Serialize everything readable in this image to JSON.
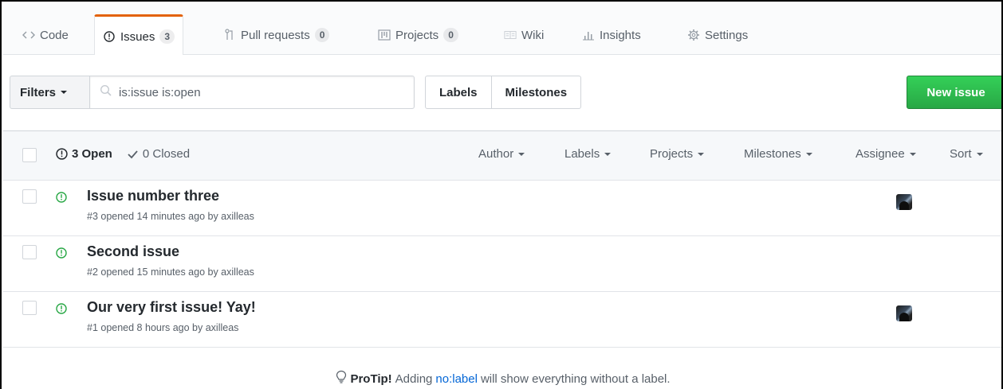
{
  "tabs": [
    {
      "label": "Code",
      "icon": "code-icon",
      "counter": null
    },
    {
      "label": "Issues",
      "icon": "issue-opened-icon",
      "counter": "3",
      "selected": true
    },
    {
      "label": "Pull requests",
      "icon": "git-pull-request-icon",
      "counter": "0"
    },
    {
      "label": "Projects",
      "icon": "project-icon",
      "counter": "0"
    },
    {
      "label": "Wiki",
      "icon": "book-icon",
      "counter": null
    },
    {
      "label": "Insights",
      "icon": "graph-icon",
      "counter": null
    },
    {
      "label": "Settings",
      "icon": "gear-icon",
      "counter": null
    }
  ],
  "subnav": {
    "filters_label": "Filters",
    "search_value": "is:issue is:open",
    "labels_label": "Labels",
    "milestones_label": "Milestones",
    "new_issue_label": "New issue"
  },
  "header": {
    "open_label": "3 Open",
    "closed_label": "0 Closed",
    "filters": [
      "Author",
      "Labels",
      "Projects",
      "Milestones",
      "Assignee",
      "Sort"
    ]
  },
  "issues": [
    {
      "title": "Issue number three",
      "meta": "#3 opened 14 minutes ago by axilleas",
      "has_assignee": true
    },
    {
      "title": "Second issue",
      "meta": "#2 opened 15 minutes ago by axilleas",
      "has_assignee": false
    },
    {
      "title": "Our very first issue! Yay!",
      "meta": "#1 opened 8 hours ago by axilleas",
      "has_assignee": true
    }
  ],
  "protip": {
    "lead": "ProTip!",
    "before": "Adding",
    "link": "no:label",
    "after": "will show everything without a label."
  },
  "colors": {
    "accent_tab": "#e36209",
    "open_green": "#28a745",
    "new_issue_green": "#2cbe4e",
    "link_blue": "#0366d6"
  }
}
